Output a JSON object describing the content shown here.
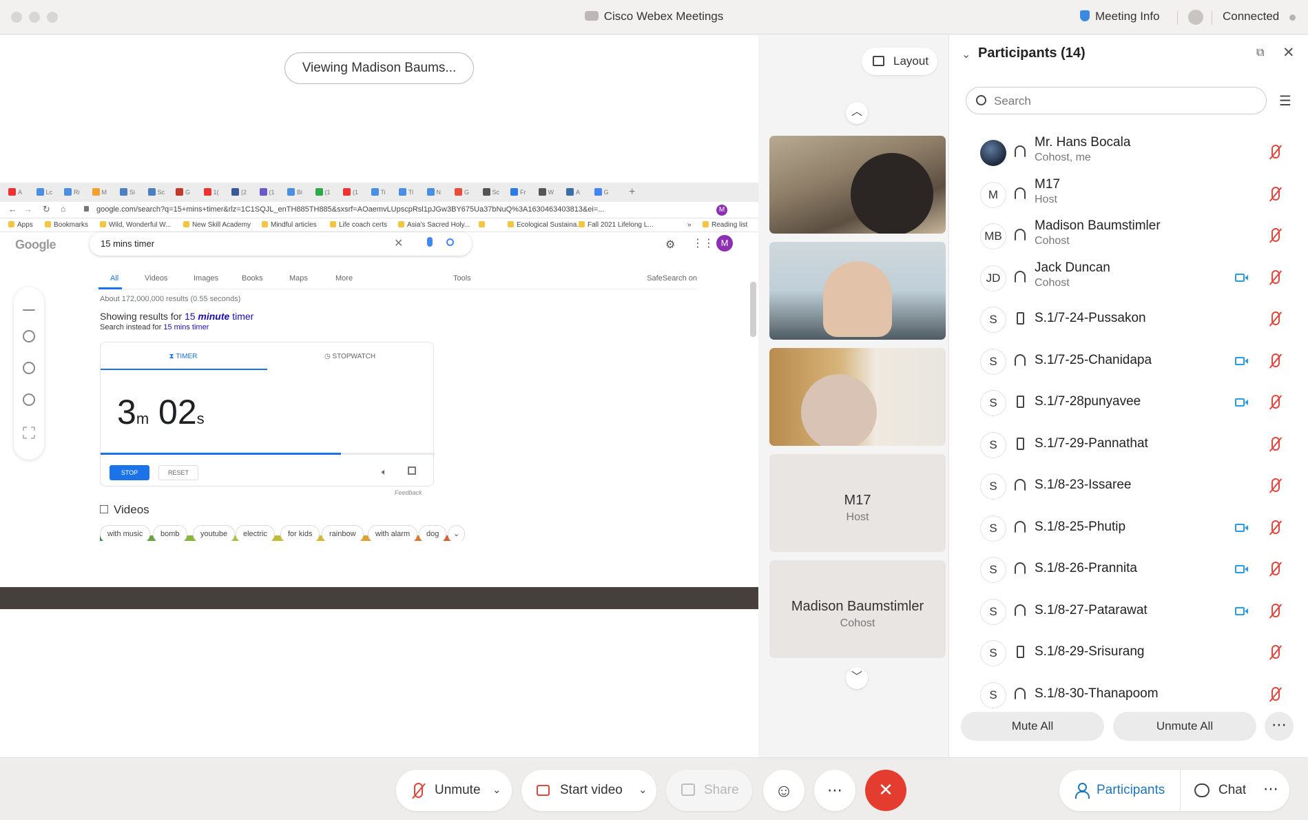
{
  "window": {
    "title": "Cisco Webex Meetings",
    "meeting_info": "Meeting Info",
    "status": "Connected"
  },
  "share": {
    "viewing_label": "Viewing Madison Baums...",
    "browser": {
      "tabs": [
        "A",
        "Lc",
        "Ri",
        "M",
        "Si",
        "Sc",
        "G",
        "1(",
        "(2",
        "(1",
        "Bi",
        "(1",
        "(1",
        "Ti",
        "Ti",
        "N",
        "G",
        "Sc",
        "Fr",
        "W",
        "A",
        "G"
      ],
      "url": "google.com/search?q=15+mins+timer&rlz=1C1SQJL_enTH885TH885&sxsrf=AOaemvLUpscpRsl1pJGw3BY675Ua37bNuQ%3A1630463403813&ei=...",
      "bookmarks": [
        "Apps",
        "Bookmarks",
        "Wild, Wonderful W...",
        "New Skill Academy",
        "Mindful articles",
        "Life coach certs",
        "Asia's Sacred Holy...",
        "",
        "Ecological Sustaina...",
        "Fall 2021 Lifelong L...",
        "»",
        "Reading list"
      ],
      "logo": "Google",
      "query": "15 mins timer",
      "search_tabs": [
        "All",
        "Videos",
        "Images",
        "Books",
        "Maps",
        "More",
        "Tools",
        "SafeSearch on"
      ],
      "results_count": "About 172,000,000 results (0.55 seconds)",
      "showing_prefix": "Showing results for",
      "showing_15": "15",
      "showing_minute": "minute",
      "showing_timer": "timer",
      "instead_prefix": "Search instead for",
      "instead_link": "15 mins timer",
      "timer_tab": "TIMER",
      "stopwatch_tab": "STOPWATCH",
      "timer_min": "3",
      "timer_min_unit": "m",
      "timer_sec": "02",
      "timer_sec_unit": "s",
      "timer_progress": 0.72,
      "stop": "STOP",
      "reset": "RESET",
      "feedback": "Feedback",
      "videos_heading": "Videos",
      "chips": [
        "with music",
        "bomb",
        "youtube",
        "electric",
        "for kids",
        "rainbow",
        "with alarm",
        "dog"
      ]
    }
  },
  "video_strip": {
    "layout_label": "Layout",
    "tiles": [
      {
        "name": "M17",
        "role": "Host"
      },
      {
        "name": "Madison Baumstimler",
        "role": "Cohost"
      }
    ]
  },
  "participants": {
    "title": "Participants (14)",
    "search_placeholder": "Search",
    "list": [
      {
        "name": "Mr. Hans Bocala",
        "role": "Cohost, me",
        "initials": "",
        "device": "audio",
        "video": false
      },
      {
        "name": "M17",
        "role": "Host",
        "initials": "M",
        "device": "audio",
        "video": false
      },
      {
        "name": "Madison Baumstimler",
        "role": "Cohost",
        "initials": "MB",
        "device": "audio",
        "video": false
      },
      {
        "name": "Jack Duncan",
        "role": "Cohost",
        "initials": "JD",
        "device": "audio",
        "video": true
      },
      {
        "name": "S.1/7-24-Pussakon",
        "role": "",
        "initials": "S",
        "device": "phone",
        "video": false
      },
      {
        "name": "S.1/7-25-Chanidapa",
        "role": "",
        "initials": "S",
        "device": "audio",
        "video": true
      },
      {
        "name": "S.1/7-28punyavee",
        "role": "",
        "initials": "S",
        "device": "phone",
        "video": true
      },
      {
        "name": "S.1/7-29-Pannathat",
        "role": "",
        "initials": "S",
        "device": "phone",
        "video": false
      },
      {
        "name": "S.1/8-23-Issaree",
        "role": "",
        "initials": "S",
        "device": "audio",
        "video": false
      },
      {
        "name": "S.1/8-25-Phutip",
        "role": "",
        "initials": "S",
        "device": "audio",
        "video": true
      },
      {
        "name": "S.1/8-26-Prannita",
        "role": "",
        "initials": "S",
        "device": "audio",
        "video": true
      },
      {
        "name": "S.1/8-27-Patarawat",
        "role": "",
        "initials": "S",
        "device": "audio",
        "video": true
      },
      {
        "name": "S.1/8-29-Srisurang",
        "role": "",
        "initials": "S",
        "device": "phone",
        "video": false
      },
      {
        "name": "S.1/8-30-Thanapoom",
        "role": "",
        "initials": "S",
        "device": "audio",
        "video": false
      }
    ],
    "mute_all": "Mute All",
    "unmute_all": "Unmute All"
  },
  "controls": {
    "unmute": "Unmute",
    "start_video": "Start video",
    "share": "Share",
    "participants": "Participants",
    "chat": "Chat"
  },
  "colors": {
    "accent_blue": "#1d75b8",
    "mute_red": "#e0473c",
    "leave_red": "#e43d2f",
    "camera_blue": "#2a9be6"
  }
}
